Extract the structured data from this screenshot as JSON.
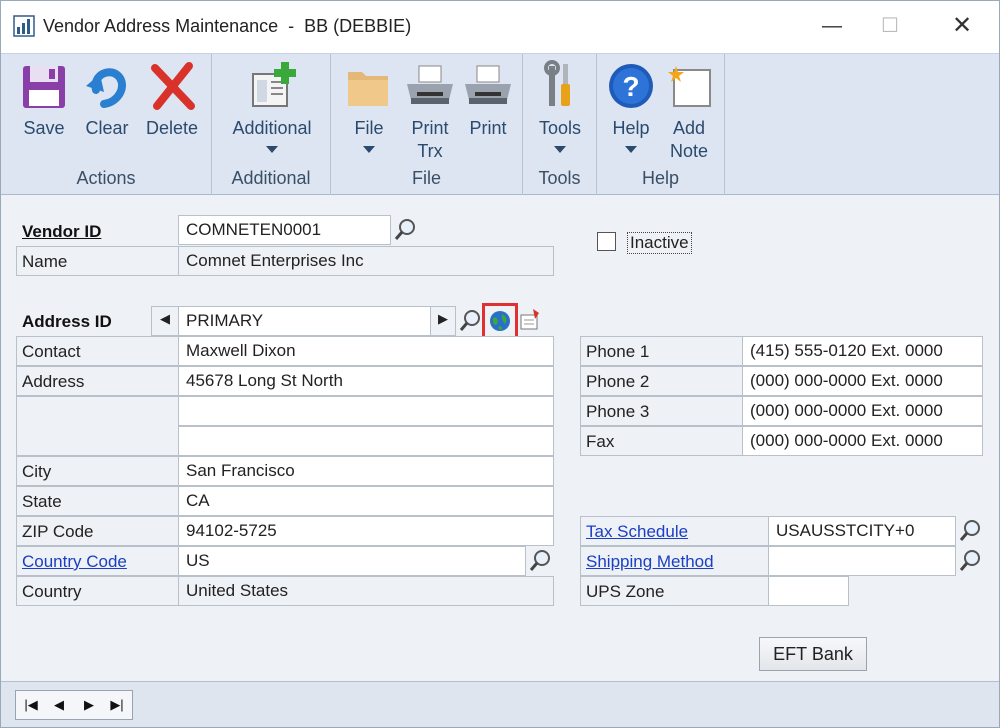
{
  "window": {
    "title": "Vendor Address Maintenance  -  BB (DEBBIE)",
    "min_glyph": "—",
    "max_glyph": "☐",
    "close_glyph": "✕"
  },
  "ribbon": {
    "groups": {
      "actions": "Actions",
      "additional": "Additional",
      "file": "File",
      "tools": "Tools",
      "help": "Help"
    },
    "buttons": {
      "save": "Save",
      "clear": "Clear",
      "delete": "Delete",
      "additional": "Additional",
      "file": "File",
      "print_trx_1": "Print",
      "print_trx_2": "Trx",
      "print": "Print",
      "tools": "Tools",
      "help": "Help",
      "add_note_1": "Add",
      "add_note_2": "Note"
    }
  },
  "form": {
    "vendor_id_label": "Vendor ID",
    "vendor_id": "COMNETEN0001",
    "name_label": "Name",
    "name": "Comnet Enterprises Inc",
    "inactive_label": "Inactive",
    "address_id_label": "Address ID",
    "address_id": "PRIMARY",
    "contact_label": "Contact",
    "contact": "Maxwell Dixon",
    "address_label": "Address",
    "address_1": "45678 Long St North",
    "address_2": "",
    "address_3": "",
    "city_label": "City",
    "city": "San Francisco",
    "state_label": "State",
    "state": "CA",
    "zip_label": "ZIP Code",
    "zip": "94102-5725",
    "country_code_label": "Country Code",
    "country_code": "US",
    "country_label": "Country",
    "country": "United States",
    "phone1_label": "Phone 1",
    "phone1": "(415) 555-0120  Ext. 0000",
    "phone2_label": "Phone 2",
    "phone2": "(000) 000-0000  Ext. 0000",
    "phone3_label": "Phone 3",
    "phone3": "(000) 000-0000  Ext. 0000",
    "fax_label": "Fax",
    "fax": "(000) 000-0000  Ext. 0000",
    "tax_schedule_label": "Tax Schedule",
    "tax_schedule": "USAUSSTCITY+0",
    "shipping_method_label": "Shipping Method",
    "shipping_method": "",
    "ups_zone_label": "UPS Zone",
    "ups_zone": "",
    "eft_bank_label": "EFT Bank"
  },
  "colors": {
    "link": "#1b3fc4",
    "highlight": "#e03030",
    "ribbon_bg": "#dce5f1"
  },
  "icons": [
    "app-icon",
    "save-icon",
    "clear-icon",
    "delete-icon",
    "additional-icon",
    "file-icon",
    "print-trx-icon",
    "print-icon",
    "tools-icon",
    "help-icon",
    "add-note-icon",
    "lookup-icon",
    "internet-info-icon",
    "address-tag-icon"
  ]
}
